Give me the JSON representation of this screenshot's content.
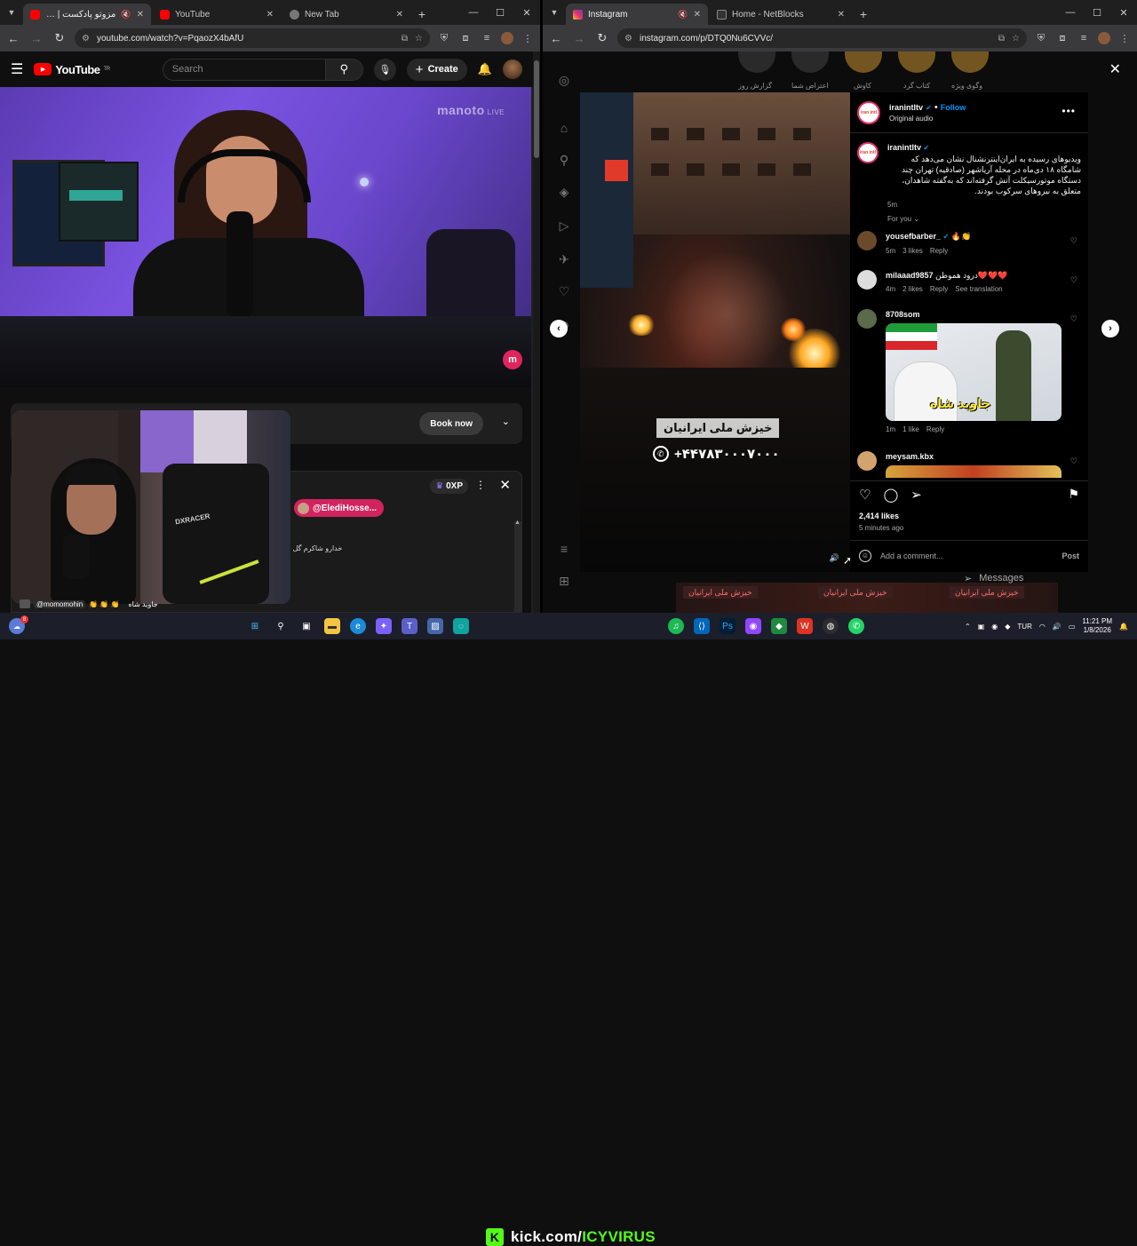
{
  "left_browser": {
    "tabs": [
      {
        "label": "مزوتو پادکست | روز دوار",
        "active": true,
        "muted": true
      },
      {
        "label": "YouTube",
        "active": false
      },
      {
        "label": "New Tab",
        "active": false
      }
    ],
    "url": "youtube.com/watch?v=PqaozX4bAfU"
  },
  "youtube": {
    "logo_text": "YouTube",
    "logo_region": "TR",
    "search_placeholder": "Search",
    "create_label": "Create",
    "watermark": "manoto",
    "watermark_sub": "LIVE",
    "book_now_label": "Book now",
    "chat_xp": "0XP",
    "chat_mention": "@ElediHosse...",
    "chat_line": "خدارو شاکرم گل دل",
    "overlay_user": "@momomohin",
    "overlay_text": "جاوید شاه"
  },
  "right_browser": {
    "tabs": [
      {
        "label": "Instagram",
        "active": true,
        "muted": true
      },
      {
        "label": "Home - NetBlocks",
        "active": false
      }
    ],
    "url": "instagram.com/p/DTQ0Nu6CVVc/"
  },
  "instagram": {
    "stories": [
      "وگوی ویژه",
      "کتاب گرد",
      "کاوش",
      "اعتراض شما",
      "گزارش روز"
    ],
    "post_author": "iranintltv",
    "follow_label": "Follow",
    "audio_label": "Original audio",
    "caption": "ویدیوهای رسیده به ایران‌اینترنشنال نشان می‌دهد که شامگاه ۱۸ دی‌ماه در محله آریاشهر (صادقیه) تهران چند دستگاه موتورسیکلت آتش گرفته‌اند که به‌گفته شاهدان، متعلق به نیروهای سرکوب بودند.",
    "caption_time": "5m",
    "for_you": "For you",
    "comments": [
      {
        "user": "yousefbarber_",
        "text": "🔥👏",
        "time": "5m",
        "likes": "3 likes",
        "reply": "Reply",
        "translate": ""
      },
      {
        "user": "milaaad9857",
        "text": "درود هموطن❤️❤️❤️",
        "time": "4m",
        "likes": "2 likes",
        "reply": "Reply",
        "translate": "See translation"
      },
      {
        "user": "8708som",
        "text": "",
        "time": "1m",
        "likes": "1 like",
        "reply": "Reply",
        "translate": ""
      },
      {
        "user": "meysam.kbx",
        "text": "",
        "time": "",
        "likes": "",
        "reply": "",
        "translate": ""
      }
    ],
    "gif_text": "جاوید شاه",
    "video_caption": "خیزش ملی ایرانیان",
    "video_phone": "+۴۴۷۸۳۰۰۰۷۰۰۰",
    "likes": "2,414 likes",
    "posted_ago": "5 minutes ago",
    "add_comment_placeholder": "Add a comment...",
    "post_label": "Post",
    "messages_label": "Messages",
    "bottom_labels": [
      "خیزش ملی ایرانیان",
      "خیزش ملی ایرانیان",
      "خیزش ملی ایرانیان"
    ]
  },
  "taskbar": {
    "notification_count": "8",
    "stream_url_prefix": "kick.com/",
    "stream_url_name": "ICYVIRUS",
    "language": "TUR",
    "time": "11:21 PM",
    "date": "1/8/2026"
  }
}
